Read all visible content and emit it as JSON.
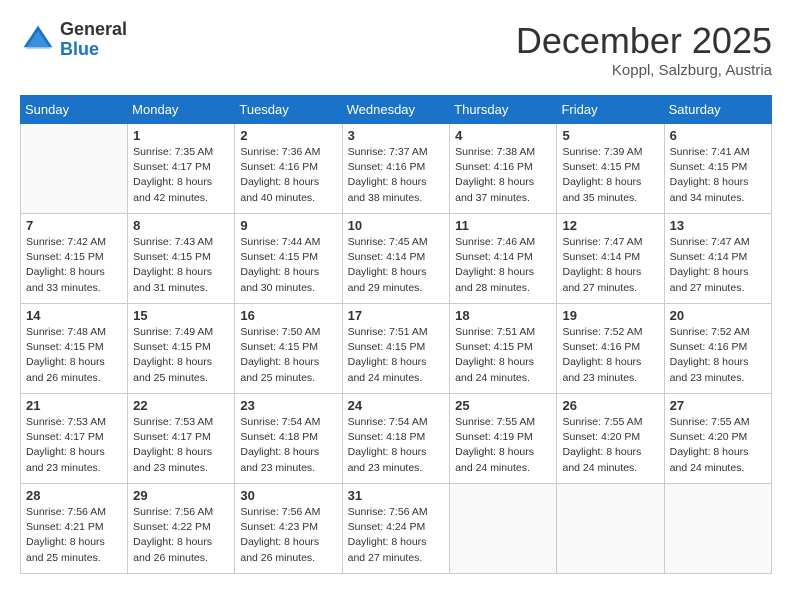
{
  "logo": {
    "general": "General",
    "blue": "Blue"
  },
  "title": "December 2025",
  "location": "Koppl, Salzburg, Austria",
  "days_of_week": [
    "Sunday",
    "Monday",
    "Tuesday",
    "Wednesday",
    "Thursday",
    "Friday",
    "Saturday"
  ],
  "weeks": [
    [
      {
        "day": "",
        "info": ""
      },
      {
        "day": "1",
        "info": "Sunrise: 7:35 AM\nSunset: 4:17 PM\nDaylight: 8 hours\nand 42 minutes."
      },
      {
        "day": "2",
        "info": "Sunrise: 7:36 AM\nSunset: 4:16 PM\nDaylight: 8 hours\nand 40 minutes."
      },
      {
        "day": "3",
        "info": "Sunrise: 7:37 AM\nSunset: 4:16 PM\nDaylight: 8 hours\nand 38 minutes."
      },
      {
        "day": "4",
        "info": "Sunrise: 7:38 AM\nSunset: 4:16 PM\nDaylight: 8 hours\nand 37 minutes."
      },
      {
        "day": "5",
        "info": "Sunrise: 7:39 AM\nSunset: 4:15 PM\nDaylight: 8 hours\nand 35 minutes."
      },
      {
        "day": "6",
        "info": "Sunrise: 7:41 AM\nSunset: 4:15 PM\nDaylight: 8 hours\nand 34 minutes."
      }
    ],
    [
      {
        "day": "7",
        "info": "Sunrise: 7:42 AM\nSunset: 4:15 PM\nDaylight: 8 hours\nand 33 minutes."
      },
      {
        "day": "8",
        "info": "Sunrise: 7:43 AM\nSunset: 4:15 PM\nDaylight: 8 hours\nand 31 minutes."
      },
      {
        "day": "9",
        "info": "Sunrise: 7:44 AM\nSunset: 4:15 PM\nDaylight: 8 hours\nand 30 minutes."
      },
      {
        "day": "10",
        "info": "Sunrise: 7:45 AM\nSunset: 4:14 PM\nDaylight: 8 hours\nand 29 minutes."
      },
      {
        "day": "11",
        "info": "Sunrise: 7:46 AM\nSunset: 4:14 PM\nDaylight: 8 hours\nand 28 minutes."
      },
      {
        "day": "12",
        "info": "Sunrise: 7:47 AM\nSunset: 4:14 PM\nDaylight: 8 hours\nand 27 minutes."
      },
      {
        "day": "13",
        "info": "Sunrise: 7:47 AM\nSunset: 4:14 PM\nDaylight: 8 hours\nand 27 minutes."
      }
    ],
    [
      {
        "day": "14",
        "info": "Sunrise: 7:48 AM\nSunset: 4:15 PM\nDaylight: 8 hours\nand 26 minutes."
      },
      {
        "day": "15",
        "info": "Sunrise: 7:49 AM\nSunset: 4:15 PM\nDaylight: 8 hours\nand 25 minutes."
      },
      {
        "day": "16",
        "info": "Sunrise: 7:50 AM\nSunset: 4:15 PM\nDaylight: 8 hours\nand 25 minutes."
      },
      {
        "day": "17",
        "info": "Sunrise: 7:51 AM\nSunset: 4:15 PM\nDaylight: 8 hours\nand 24 minutes."
      },
      {
        "day": "18",
        "info": "Sunrise: 7:51 AM\nSunset: 4:15 PM\nDaylight: 8 hours\nand 24 minutes."
      },
      {
        "day": "19",
        "info": "Sunrise: 7:52 AM\nSunset: 4:16 PM\nDaylight: 8 hours\nand 23 minutes."
      },
      {
        "day": "20",
        "info": "Sunrise: 7:52 AM\nSunset: 4:16 PM\nDaylight: 8 hours\nand 23 minutes."
      }
    ],
    [
      {
        "day": "21",
        "info": "Sunrise: 7:53 AM\nSunset: 4:17 PM\nDaylight: 8 hours\nand 23 minutes."
      },
      {
        "day": "22",
        "info": "Sunrise: 7:53 AM\nSunset: 4:17 PM\nDaylight: 8 hours\nand 23 minutes."
      },
      {
        "day": "23",
        "info": "Sunrise: 7:54 AM\nSunset: 4:18 PM\nDaylight: 8 hours\nand 23 minutes."
      },
      {
        "day": "24",
        "info": "Sunrise: 7:54 AM\nSunset: 4:18 PM\nDaylight: 8 hours\nand 23 minutes."
      },
      {
        "day": "25",
        "info": "Sunrise: 7:55 AM\nSunset: 4:19 PM\nDaylight: 8 hours\nand 24 minutes."
      },
      {
        "day": "26",
        "info": "Sunrise: 7:55 AM\nSunset: 4:20 PM\nDaylight: 8 hours\nand 24 minutes."
      },
      {
        "day": "27",
        "info": "Sunrise: 7:55 AM\nSunset: 4:20 PM\nDaylight: 8 hours\nand 24 minutes."
      }
    ],
    [
      {
        "day": "28",
        "info": "Sunrise: 7:56 AM\nSunset: 4:21 PM\nDaylight: 8 hours\nand 25 minutes."
      },
      {
        "day": "29",
        "info": "Sunrise: 7:56 AM\nSunset: 4:22 PM\nDaylight: 8 hours\nand 26 minutes."
      },
      {
        "day": "30",
        "info": "Sunrise: 7:56 AM\nSunset: 4:23 PM\nDaylight: 8 hours\nand 26 minutes."
      },
      {
        "day": "31",
        "info": "Sunrise: 7:56 AM\nSunset: 4:24 PM\nDaylight: 8 hours\nand 27 minutes."
      },
      {
        "day": "",
        "info": ""
      },
      {
        "day": "",
        "info": ""
      },
      {
        "day": "",
        "info": ""
      }
    ]
  ]
}
